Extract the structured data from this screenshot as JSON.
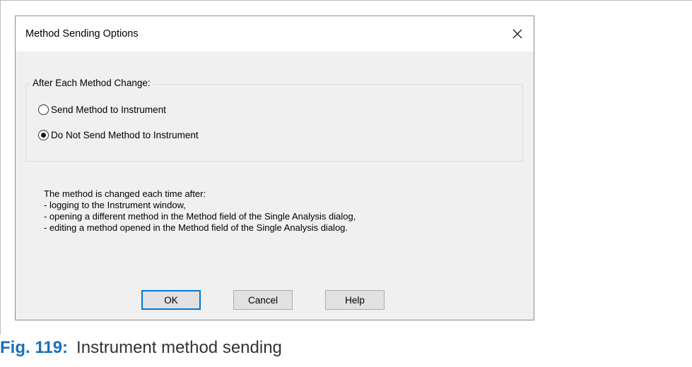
{
  "dialog": {
    "title": "Method Sending Options",
    "close_icon": "close-icon",
    "group": {
      "legend": "After Each Method Change:",
      "options": [
        {
          "label": "Send Method to Instrument",
          "selected": false
        },
        {
          "label": "Do Not Send Method to Instrument",
          "selected": true
        }
      ]
    },
    "info_lines": [
      "The method is changed each time after:",
      "- logging to the Instrument window,",
      "- opening a different method in the Method field of the Single Analysis dialog,",
      "- editing a method opened in the Method field of the Single Analysis dialog."
    ],
    "buttons": {
      "ok": "OK",
      "cancel": "Cancel",
      "help": "Help"
    }
  },
  "caption": {
    "label": "Fig. 119:",
    "text": "Instrument method sending"
  },
  "colors": {
    "accent": "#0078d7",
    "caption_label": "#1a70b8",
    "dialog_bg": "#f0f0f0"
  }
}
